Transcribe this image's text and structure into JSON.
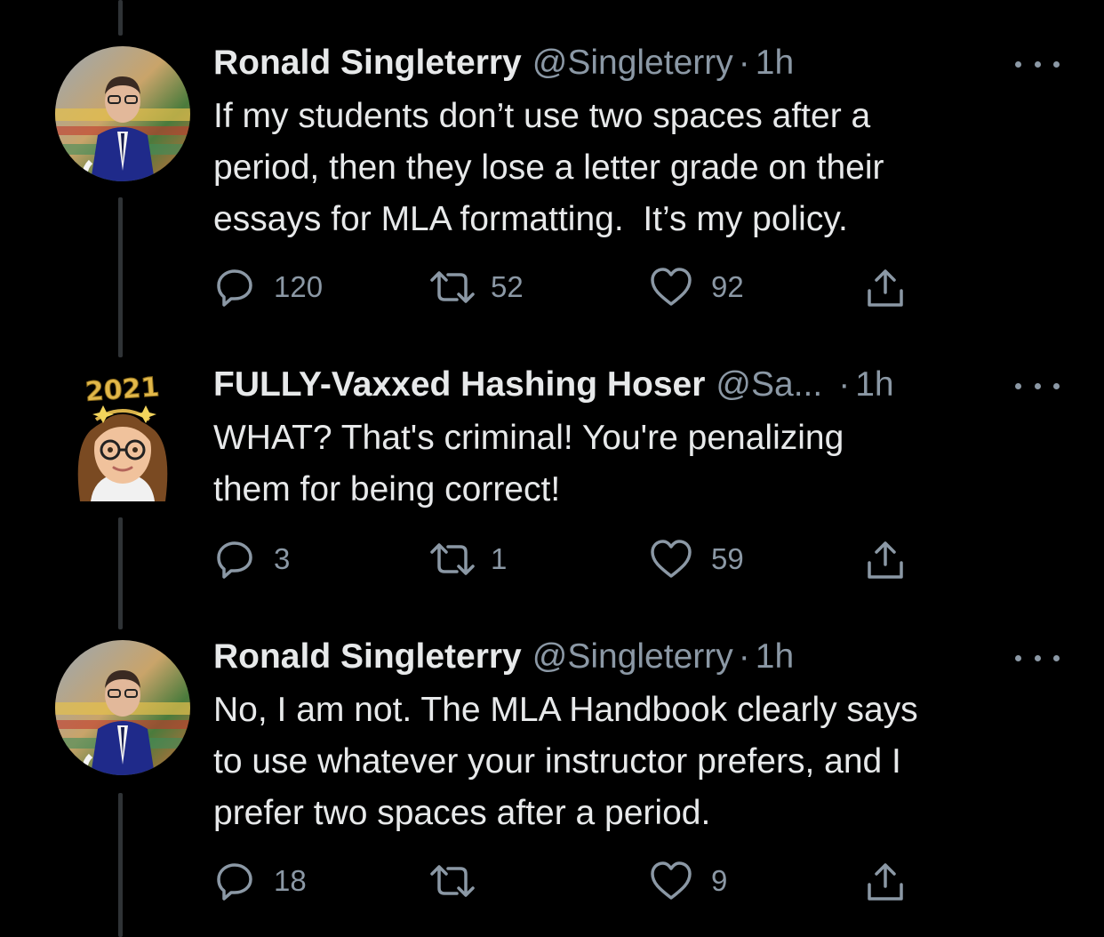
{
  "colors": {
    "background": "#000000",
    "text": "#e7e9ea",
    "secondary": "#8b98a5",
    "thread_line": "#2f3336"
  },
  "tweets": [
    {
      "name": "Ronald Singleterry",
      "handle": "@Singleterry",
      "dot": "·",
      "time": "1h",
      "text": "If my students don’t use two spaces after a\nperiod, then they lose a letter grade on their\nessays for MLA formatting.  It’s my policy.",
      "avatar_icon": "profile-photo-man-in-suit",
      "replies": "120",
      "retweets": "52",
      "likes": "92"
    },
    {
      "name": "FULLY-Vaxxed Hashing Hoser",
      "handle": "@Sa...",
      "dot": "·",
      "time": "1h",
      "text": "WHAT? That's criminal! You're penalizing\nthem for being correct!",
      "avatar_icon": "cartoon-avatar-woman-2021-headband",
      "avatar_badge": "2021",
      "replies": "3",
      "retweets": "1",
      "likes": "59"
    },
    {
      "name": "Ronald Singleterry",
      "handle": "@Singleterry",
      "dot": "·",
      "time": "1h",
      "text": "No, I am not. The MLA Handbook clearly says\nto use whatever your instructor prefers, and I\nprefer two spaces after a period.",
      "avatar_icon": "profile-photo-man-in-suit",
      "replies": "18",
      "retweets": "",
      "likes": "9"
    }
  ]
}
